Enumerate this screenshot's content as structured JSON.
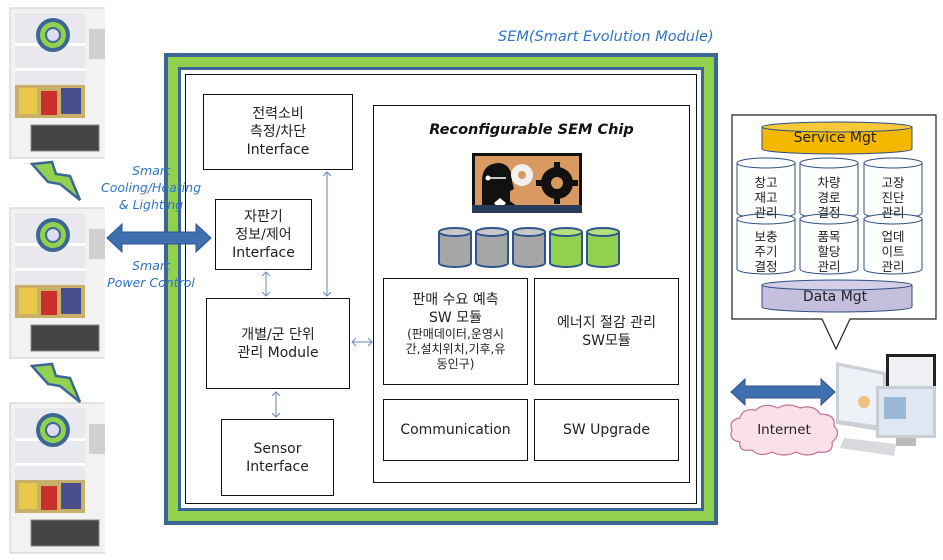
{
  "sem_title": "SEM(Smart Evolution Module)",
  "left_labels": {
    "cooling": [
      "Smart",
      "Cooling/Heating",
      "& Lighting"
    ],
    "power": [
      "Smart",
      "Power Control"
    ]
  },
  "vending_machines": [
    {
      "name": "vending-machine-1"
    },
    {
      "name": "vending-machine-2"
    },
    {
      "name": "vending-machine-3"
    }
  ],
  "modules": {
    "power_interface": [
      "전력소비",
      "측정/차단",
      "Interface"
    ],
    "vending_interface": [
      "자판기",
      "정보/제어",
      "Interface"
    ],
    "group_module": [
      "개별/군 단위",
      "관리 Module"
    ],
    "sensor_interface": [
      "Sensor",
      "Interface"
    ]
  },
  "chip": {
    "title": "Reconfigurable SEM Chip",
    "memory_blocks": [
      {
        "state": "used",
        "color": "#a6a6a6"
      },
      {
        "state": "used",
        "color": "#a6a6a6"
      },
      {
        "state": "used",
        "color": "#a6a6a6"
      },
      {
        "state": "free",
        "color": "#92d050"
      },
      {
        "state": "free",
        "color": "#92d050"
      }
    ],
    "sales_forecast": {
      "title": [
        "판매 수요 예측",
        "SW 모듈"
      ],
      "detail": [
        "(판매데이터,운영시",
        "간,설치위치,기후,유",
        "동인구)"
      ]
    },
    "energy_saving": [
      "에너지 절감 관리",
      "SW모듈"
    ],
    "communication": "Communication",
    "sw_upgrade": "SW Upgrade"
  },
  "server_panel": {
    "service_mgt": "Service Mgt",
    "data_mgt": "Data Mgt",
    "services": [
      [
        "창고",
        "재고",
        "관리"
      ],
      [
        "차량",
        "경로",
        "결정"
      ],
      [
        "고장",
        "진단",
        "관리"
      ],
      [
        "보충",
        "주기",
        "결정"
      ],
      [
        "품목",
        "할당",
        "관리"
      ],
      [
        "업데",
        "이트",
        "관리"
      ]
    ]
  },
  "internet_label": "Internet",
  "colors": {
    "frame_blue": "#3c6694",
    "frame_green": "#92d050",
    "service_gold": "#f5b800",
    "data_lavender": "#c5bedc",
    "arrow_blue": "#3f6fb0",
    "cloud_pink": "#fbe0e8",
    "label_blue": "#2e75c6"
  }
}
